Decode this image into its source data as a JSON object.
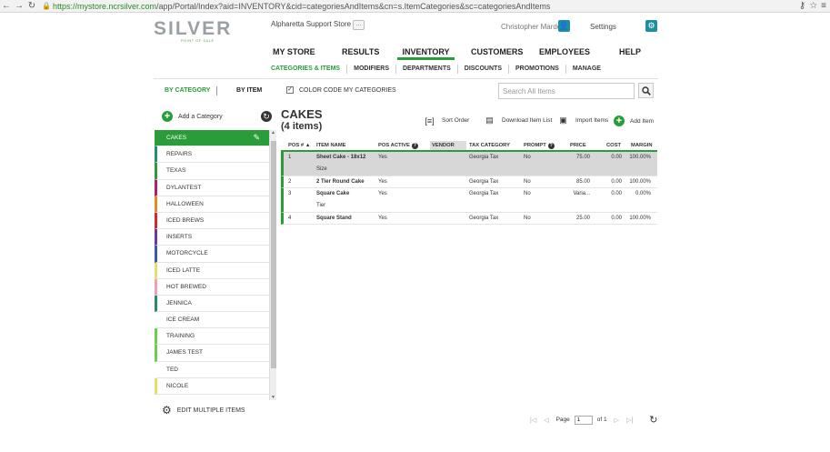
{
  "browser": {
    "url_host": "https://mystore.ncrsilver.com",
    "url_path": "/app/Portal/Index?aid=INVENTORY&cid=categoriesAndItems&cn=s.ItemCategories&sc=categoriesAndItems"
  },
  "header": {
    "logo": "SILVER",
    "logo_sub": "POINT OF SALE",
    "store": "Alpharetta Support Store",
    "store_btn": "...",
    "user": "Christopher Marden",
    "settings": "Settings"
  },
  "mainnav": [
    "MY STORE",
    "RESULTS",
    "INVENTORY",
    "CUSTOMERS",
    "EMPLOYEES",
    "HELP"
  ],
  "subnav": [
    "CATEGORIES & ITEMS",
    "MODIFIERS",
    "DEPARTMENTS",
    "DISCOUNTS",
    "PROMOTIONS",
    "MANAGE"
  ],
  "toolbar": {
    "by_category": "BY CATEGORY",
    "by_item": "BY ITEM",
    "color_code": "COLOR CODE MY CATEGORIES",
    "search_placeholder": "Search All Items"
  },
  "left": {
    "add_category": "Add a Category",
    "edit_multiple": "EDIT MULTIPLE ITEMS",
    "categories": [
      {
        "name": "CAKES",
        "color": "#2a9d3a",
        "active": true
      },
      {
        "name": "REPAIRS",
        "color": "#1e8f7a"
      },
      {
        "name": "TEXAS",
        "color": "#2a9d3a"
      },
      {
        "name": "DYLANTEST",
        "color": "#b0206a"
      },
      {
        "name": "HALLOWEEN",
        "color": "#e08a2a"
      },
      {
        "name": "ICED BREWS",
        "color": "#d12a2a"
      },
      {
        "name": "INSERTS",
        "color": "#6a3aa0"
      },
      {
        "name": "MOTORCYCLE",
        "color": "#3a5ab0"
      },
      {
        "name": "ICED LATTE",
        "color": "#e8e06a"
      },
      {
        "name": "HOT BREWED",
        "color": "#f0a0b0"
      },
      {
        "name": "JENNICA",
        "color": "#2a8a6a"
      },
      {
        "name": "ICE CREAM",
        "color": "#ffffff"
      },
      {
        "name": "TRAINING",
        "color": "#6ad04a"
      },
      {
        "name": "JAMES TEST",
        "color": "#6ad04a"
      },
      {
        "name": "TED",
        "color": "#ffffff"
      },
      {
        "name": "NICOLE",
        "color": "#e8e06a"
      }
    ]
  },
  "right": {
    "title": "CAKES",
    "count": "(4 items)",
    "actions": {
      "sort": "Sort Order",
      "download": "Download Item List",
      "import": "Import Items",
      "add": "Add Item"
    },
    "columns": [
      "POS #",
      "ITEM NAME",
      "POS ACTIVE",
      "VENDOR",
      "TAX CATEGORY",
      "PROMPT",
      "PRICE",
      "COST",
      "MARGIN"
    ],
    "rows": [
      {
        "pos": "1",
        "name": "Sheet Cake - 18x12",
        "name2": "Size",
        "active": "Yes",
        "vendor": "",
        "tax": "Georgia Tax",
        "prompt": "No",
        "price": "75.00",
        "cost": "0.00",
        "margin": "100.00%",
        "selected": true
      },
      {
        "pos": "2",
        "name": "2 Tier Round Cake",
        "name2": "",
        "active": "Yes",
        "vendor": "",
        "tax": "Georgia Tax",
        "prompt": "No",
        "price": "85.00",
        "cost": "0.00",
        "margin": "100.00%"
      },
      {
        "pos": "3",
        "name": "Square Cake",
        "name2": "Tier",
        "active": "Yes",
        "vendor": "",
        "tax": "Georgia Tax",
        "prompt": "No",
        "price": "Varia...",
        "cost": "0.00",
        "margin": "0.00%"
      },
      {
        "pos": "4",
        "name": "Square Stand",
        "name2": "",
        "active": "Yes",
        "vendor": "",
        "tax": "Georgia Tax",
        "prompt": "No",
        "price": "25.00",
        "cost": "0.00",
        "margin": "100.00%"
      }
    ]
  },
  "pager": {
    "page_label": "Page",
    "page_value": "1",
    "of_label": "of 1"
  }
}
